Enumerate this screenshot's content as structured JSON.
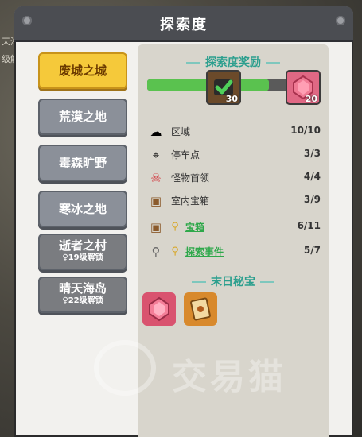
{
  "background": {
    "map_labels": [
      "天海",
      "级解"
    ]
  },
  "header": {
    "title": "探索度"
  },
  "tabs": [
    {
      "name": "废城之城",
      "sub": "",
      "state": "active"
    },
    {
      "name": "荒漠之地",
      "sub": "",
      "state": "normal"
    },
    {
      "name": "毒森旷野",
      "sub": "",
      "state": "normal"
    },
    {
      "name": "寒冰之地",
      "sub": "",
      "state": "normal"
    },
    {
      "name": "逝者之村",
      "sub": "♀19级解锁",
      "state": "locked"
    },
    {
      "name": "晴天海岛",
      "sub": "♀22级解锁",
      "state": "locked"
    }
  ],
  "reward": {
    "title": "探索度奖励",
    "progress": 0.72,
    "milestones": [
      {
        "value": "30",
        "icon": "checked-chest-icon",
        "color": "#6b4a2a"
      },
      {
        "value": "20",
        "icon": "red-gem-icon",
        "color": "#e0587a"
      }
    ]
  },
  "stats": [
    {
      "icon": "cloud-icon",
      "label": "区域",
      "value": "10/10",
      "link": false
    },
    {
      "icon": "map-pin-icon",
      "label": "停车点",
      "value": "3/3",
      "link": false
    },
    {
      "icon": "skull-icon",
      "label": "怪物首领",
      "value": "4/4",
      "link": false
    },
    {
      "icon": "chest-icon",
      "label": "室内宝箱",
      "value": "3/9",
      "link": false
    },
    {
      "icon": "chest-icon",
      "label": "宝箱",
      "value": "6/11",
      "link": true
    },
    {
      "icon": "magnifier-icon",
      "label": "探索事件",
      "value": "5/7",
      "link": true
    }
  ],
  "treasure": {
    "title": "末日秘宝",
    "items": [
      {
        "icon": "red-gem-icon",
        "color": "#d9536f"
      },
      {
        "icon": "scroll-map-icon",
        "color": "#d8892c"
      }
    ]
  },
  "watermark": {
    "text": "交易猫"
  },
  "colors": {
    "accent": "#2c9f8e",
    "active_tab": "#f5c93a",
    "progress": "#5ac24f"
  }
}
